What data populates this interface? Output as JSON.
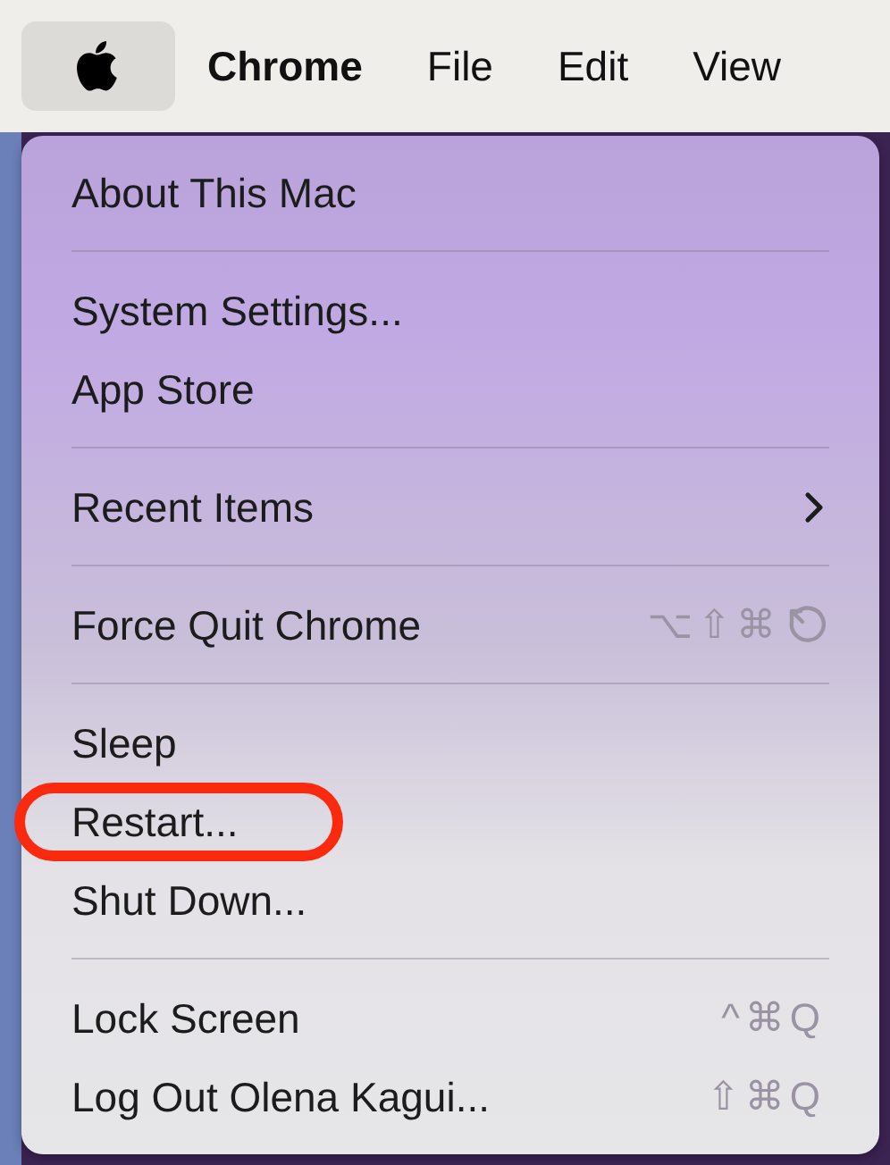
{
  "menu_bar": {
    "items": [
      {
        "kind": "apple",
        "selected": true
      },
      {
        "kind": "app",
        "label": "Chrome",
        "selected": false
      },
      {
        "kind": "menu",
        "label": "File",
        "selected": false
      },
      {
        "kind": "menu",
        "label": "Edit",
        "selected": false
      },
      {
        "kind": "menu",
        "label": "View",
        "selected": false
      }
    ]
  },
  "dropdown": {
    "groups": [
      [
        {
          "label": "About This Mac"
        }
      ],
      [
        {
          "label": "System Settings..."
        },
        {
          "label": "App Store"
        }
      ],
      [
        {
          "label": "Recent Items",
          "submenu": true
        }
      ],
      [
        {
          "label": "Force Quit Chrome",
          "shortcut": "⌥⇧⌘",
          "escape_key": true
        }
      ],
      [
        {
          "label": "Sleep"
        },
        {
          "label": "Restart...",
          "circled": true
        },
        {
          "label": "Shut Down..."
        }
      ],
      [
        {
          "label": "Lock Screen",
          "shortcut": "^⌘Q"
        },
        {
          "label": "Log Out Olena Kagui...",
          "shortcut": "⇧⌘Q"
        }
      ]
    ]
  }
}
